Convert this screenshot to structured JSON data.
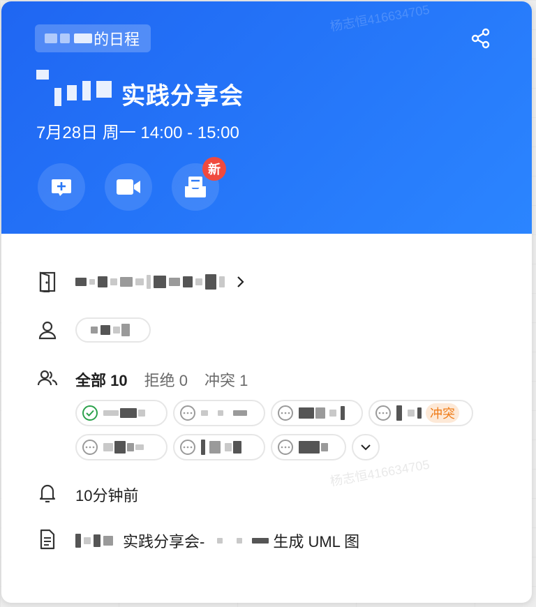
{
  "header": {
    "owner_suffix": "的日程",
    "title_suffix": "实践分享会",
    "time": "7月28日 周一 14:00 - 15:00",
    "new_badge": "新",
    "colors": {
      "accent": "#1f66f2",
      "badge": "#f04a3f"
    }
  },
  "icons": {
    "share": "share-icon",
    "chat": "add-chat-icon",
    "video": "video-camera-icon",
    "minutes": "inbox-doc-icon",
    "room": "door-icon",
    "organizer": "person-icon",
    "attendees": "people-icon",
    "reminder": "bell-icon",
    "description": "document-icon"
  },
  "attendees": {
    "all_label": "全部",
    "all_count": "10",
    "declined_label": "拒绝",
    "declined_count": "0",
    "conflict_label": "冲突",
    "conflict_count": "1",
    "conflict_tag": "冲突"
  },
  "reminder": {
    "text": "10分钟前"
  },
  "description": {
    "part1": "实践分享会-",
    "part2": "生成 UML 图"
  },
  "watermark": "杨志恒416634705"
}
